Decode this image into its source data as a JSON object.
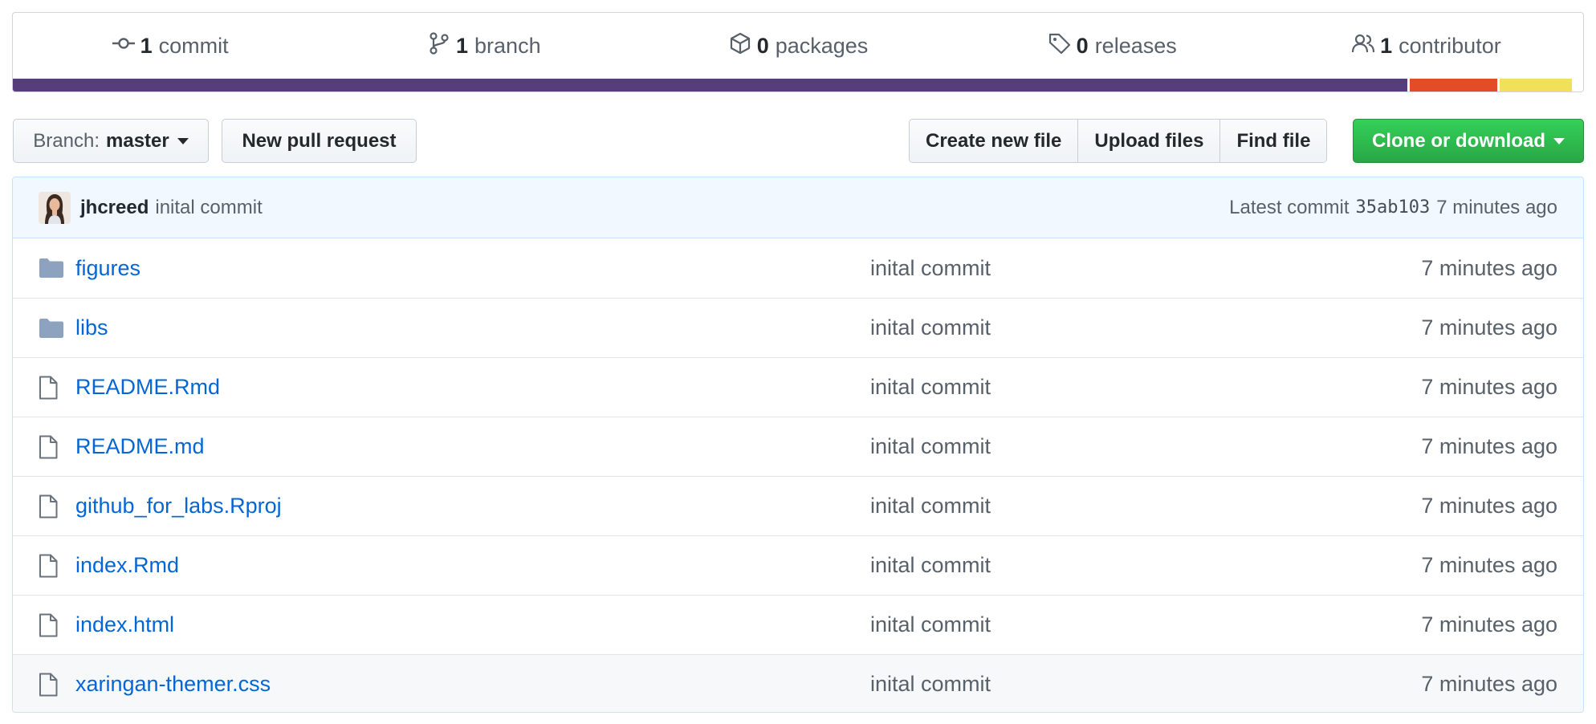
{
  "stats": {
    "commits": {
      "num": "1",
      "label": "commit",
      "icon": "commit-icon"
    },
    "branches": {
      "num": "1",
      "label": "branch",
      "icon": "branch-icon"
    },
    "packages": {
      "num": "0",
      "label": "packages",
      "icon": "package-icon"
    },
    "releases": {
      "num": "0",
      "label": "releases",
      "icon": "tag-icon"
    },
    "contributors": {
      "num": "1",
      "label": "contributor",
      "icon": "people-icon"
    }
  },
  "language_bar": {
    "segments": [
      {
        "color": "#563d7c",
        "fraction": 0.888
      },
      {
        "color": "#e34c26",
        "fraction": 0.056
      },
      {
        "color": "#f1e05a",
        "fraction": 0.046
      }
    ]
  },
  "toolbar": {
    "branch_prefix": "Branch:",
    "branch_name": "master",
    "new_pull_request": "New pull request",
    "create_new_file": "Create new file",
    "upload_files": "Upload files",
    "find_file": "Find file",
    "clone_or_download": "Clone or download"
  },
  "latest_commit": {
    "author": "jhcreed",
    "message": "inital commit",
    "label": "Latest commit",
    "sha": "35ab103",
    "age": "7 minutes ago"
  },
  "files": [
    {
      "type": "folder",
      "name": "figures",
      "message": "inital commit",
      "age": "7 minutes ago"
    },
    {
      "type": "folder",
      "name": "libs",
      "message": "inital commit",
      "age": "7 minutes ago"
    },
    {
      "type": "file",
      "name": "README.Rmd",
      "message": "inital commit",
      "age": "7 minutes ago"
    },
    {
      "type": "file",
      "name": "README.md",
      "message": "inital commit",
      "age": "7 minutes ago"
    },
    {
      "type": "file",
      "name": "github_for_labs.Rproj",
      "message": "inital commit",
      "age": "7 minutes ago"
    },
    {
      "type": "file",
      "name": "index.Rmd",
      "message": "inital commit",
      "age": "7 minutes ago"
    },
    {
      "type": "file",
      "name": "index.html",
      "message": "inital commit",
      "age": "7 minutes ago"
    },
    {
      "type": "file",
      "name": "xaringan-themer.css",
      "message": "inital commit",
      "age": "7 minutes ago"
    }
  ],
  "colors": {
    "link": "#0366d6",
    "clone_button": "#2ea44f",
    "folder_icon": "#79b8ff"
  }
}
